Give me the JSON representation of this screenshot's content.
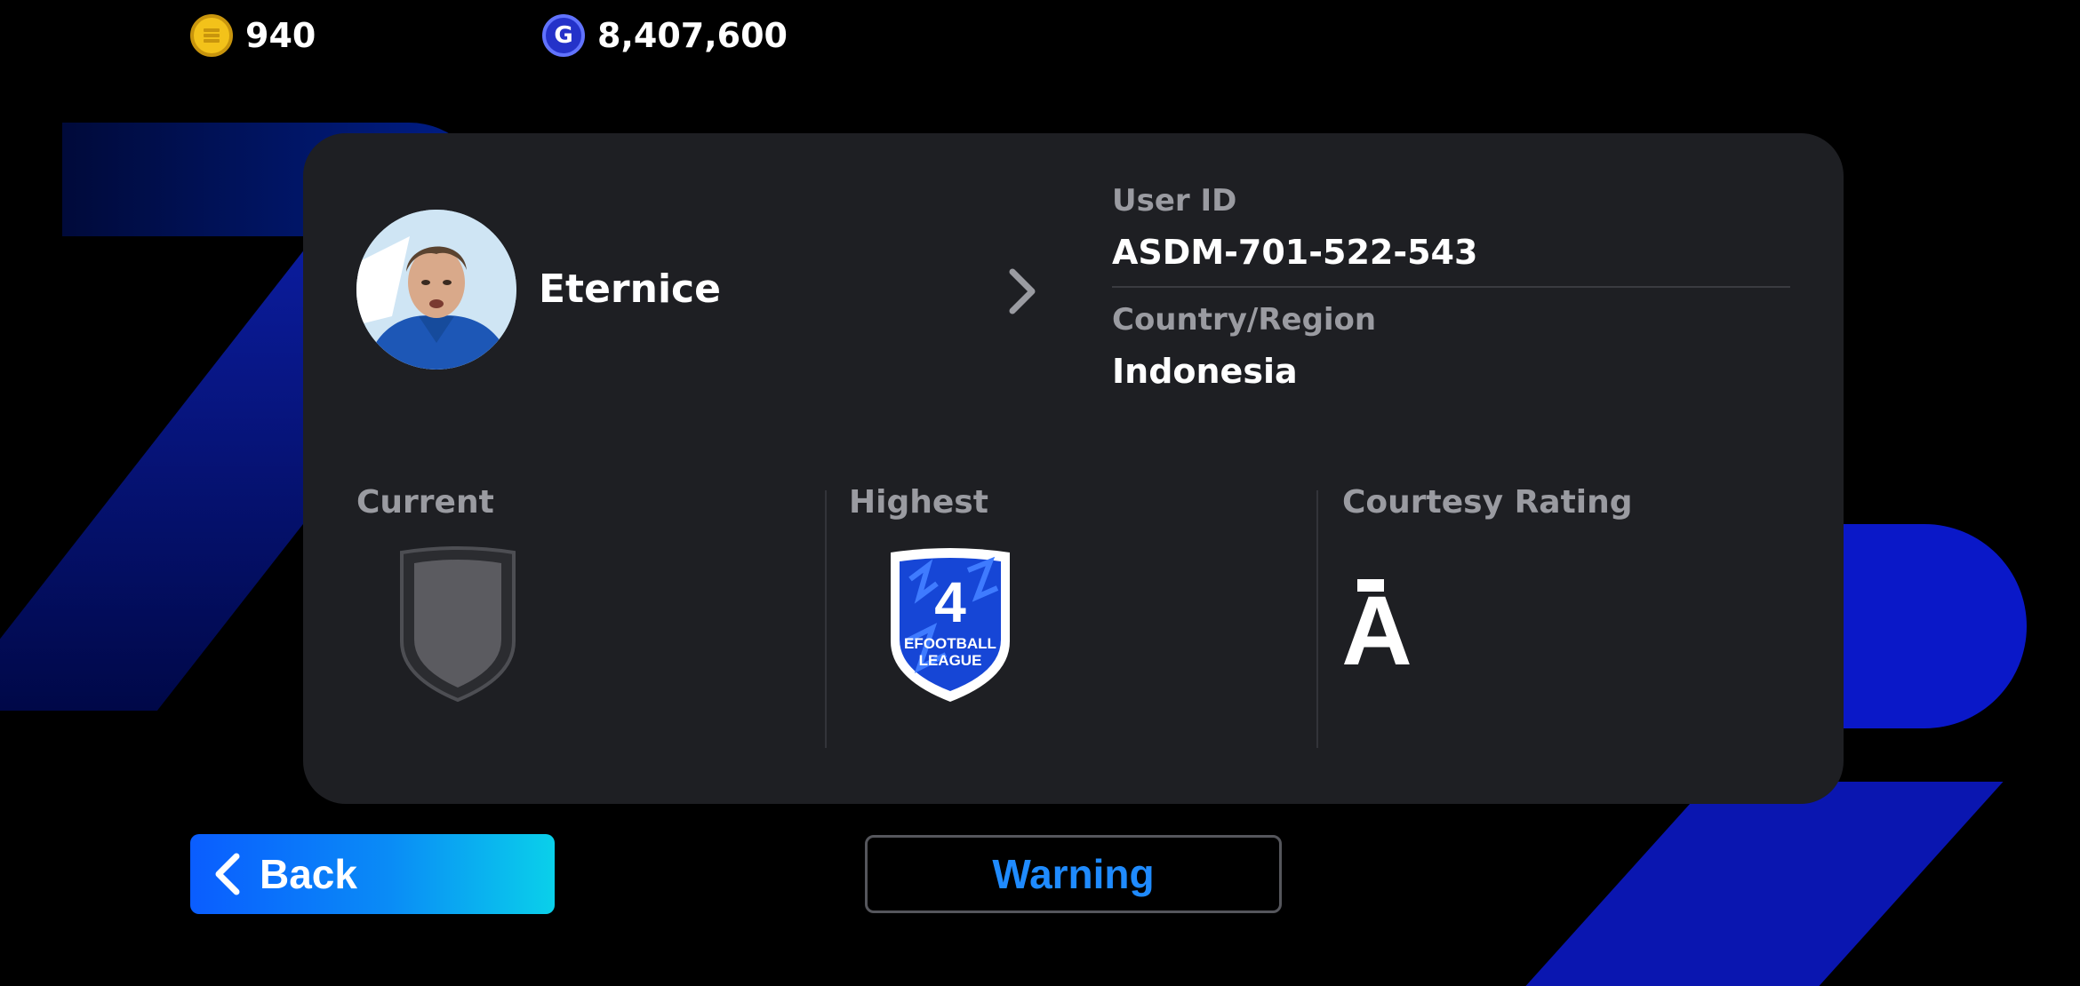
{
  "currencies": {
    "coins": {
      "icon": "coin-icon",
      "value": "940"
    },
    "gp": {
      "icon": "gp-icon",
      "glyph": "G",
      "value": "8,407,600"
    }
  },
  "profile": {
    "name": "Eternice",
    "avatar": "player-avatar",
    "user_id_label": "User ID",
    "user_id": "ASDM-701-522-543",
    "country_label": "Country/Region",
    "country": "Indonesia"
  },
  "stats": {
    "current_label": "Current",
    "current_badge": "empty-division-badge",
    "highest_label": "Highest",
    "highest_badge": {
      "number": "4",
      "line1": "EFOOTBALL",
      "line2": "LEAGUE"
    },
    "courtesy_label": "Courtesy Rating",
    "courtesy_value": "A"
  },
  "buttons": {
    "back": "Back",
    "warning": "Warning"
  },
  "colors": {
    "panel": "#1e1f23",
    "accent_blue": "#1f8bff",
    "back_gradient_start": "#0a5dff",
    "back_gradient_end": "#0ad0ea"
  }
}
